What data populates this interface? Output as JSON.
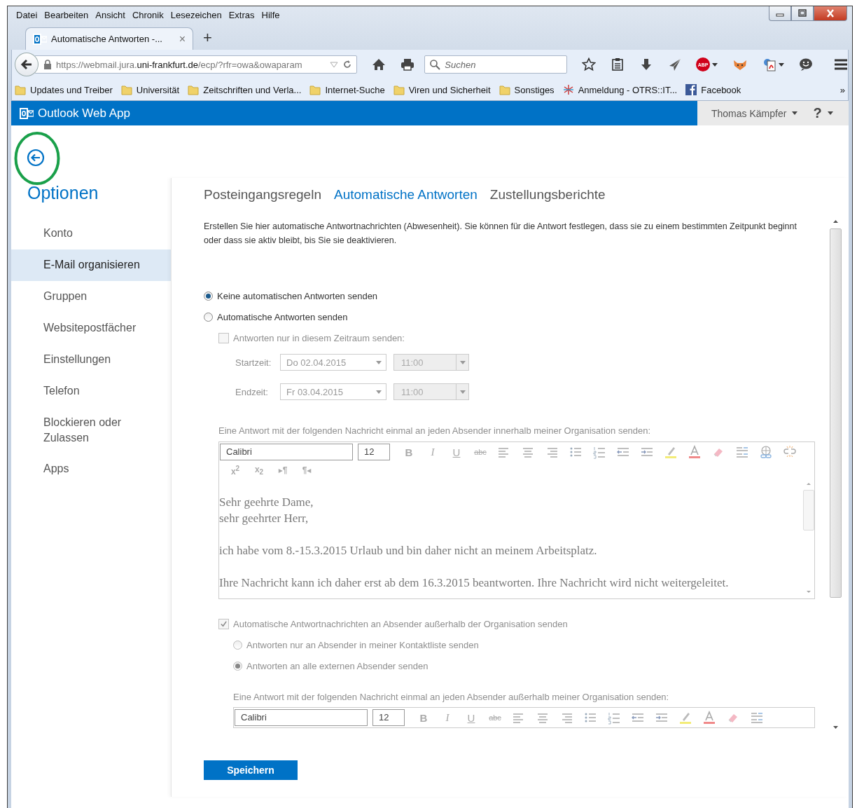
{
  "browser": {
    "menu": [
      "Datei",
      "Bearbeiten",
      "Ansicht",
      "Chronik",
      "Lesezeichen",
      "Extras",
      "Hilfe"
    ],
    "tab": {
      "title": "Automatische Antworten -...",
      "close": "×"
    },
    "new_tab": "+",
    "url": {
      "prefix": "https://webmail.jura.",
      "domain": "uni-frankfurt.de",
      "path": "/ecp/?rfr=owa&owaparam"
    },
    "search": {
      "placeholder": "Suchen"
    },
    "abp": "ABP",
    "bookmarks": [
      {
        "label": "Updates und Treiber",
        "kind": "folder"
      },
      {
        "label": "Universität",
        "kind": "folder"
      },
      {
        "label": "Zeitschriften und Verla...",
        "kind": "folder"
      },
      {
        "label": "Internet-Suche",
        "kind": "folder"
      },
      {
        "label": "Viren und Sicherheit",
        "kind": "folder"
      },
      {
        "label": "Sonstiges",
        "kind": "folder"
      },
      {
        "label": "Anmeldung - OTRS::IT...",
        "kind": "star"
      },
      {
        "label": "Facebook",
        "kind": "logo"
      }
    ],
    "bookmarks_more": "»"
  },
  "app": {
    "title": "Outlook Web App",
    "user": "Thomas Kämpfer",
    "help": "?"
  },
  "sidebar": {
    "title": "Optionen",
    "items": [
      {
        "label": "Konto",
        "selected": false
      },
      {
        "label": "E-Mail organisieren",
        "selected": true
      },
      {
        "label": "Gruppen",
        "selected": false
      },
      {
        "label": "Websitepostfächer",
        "selected": false
      },
      {
        "label": "Einstellungen",
        "selected": false
      },
      {
        "label": "Telefon",
        "selected": false
      },
      {
        "label": "Blockieren oder Zulassen",
        "selected": false
      },
      {
        "label": "Apps",
        "selected": false
      }
    ]
  },
  "tabs": [
    {
      "label": "Posteingangsregeln",
      "selected": false
    },
    {
      "label": "Automatische Antworten",
      "selected": true
    },
    {
      "label": "Zustellungsberichte",
      "selected": false
    }
  ],
  "description": "Erstellen Sie hier automatische Antwortnachrichten (Abwesenheit). Sie können für die Antwort festlegen, dass sie zu einem bestimmten Zeitpunkt beginnt oder dass sie aktiv bleibt, bis Sie sie deaktivieren.",
  "reply_mode": [
    {
      "label": "Keine automatischen Antworten senden",
      "selected": true
    },
    {
      "label": "Automatische Antworten senden",
      "selected": false
    }
  ],
  "period": {
    "label": "Antworten nur in diesem Zeitraum senden:",
    "checked": false,
    "disabled": true,
    "rows": [
      {
        "label": "Startzeit:",
        "date": "Do 02.04.2015",
        "time": "11:00"
      },
      {
        "label": "Endzeit:",
        "date": "Fr 03.04.2015",
        "time": "11:00"
      }
    ]
  },
  "internal": {
    "label": "Eine Antwort mit der folgenden Nachricht einmal an jeden Absender innerhalb meiner Organisation senden:",
    "disabled": true,
    "editor": {
      "font": "Calibri",
      "size": "12",
      "tools": [
        {
          "kind": "bold",
          "glyph": "B"
        },
        {
          "kind": "italic",
          "glyph": "I"
        },
        {
          "kind": "underline",
          "glyph": "U"
        },
        {
          "kind": "strike",
          "glyph": "abc"
        },
        {
          "kind": "align-left"
        },
        {
          "kind": "align-center"
        },
        {
          "kind": "align-right"
        },
        {
          "kind": "bullets"
        },
        {
          "kind": "numbering"
        },
        {
          "kind": "outdent"
        },
        {
          "kind": "indent"
        },
        {
          "kind": "highlight"
        },
        {
          "kind": "font-color"
        },
        {
          "kind": "eraser"
        },
        {
          "kind": "styles"
        },
        {
          "kind": "link"
        },
        {
          "kind": "unlink"
        }
      ],
      "tools_row2": [
        {
          "kind": "text",
          "glyph": "x$^{2}$"
        },
        {
          "kind": "text",
          "glyph": "x$_{2}$"
        },
        {
          "kind": "text",
          "glyph": "▸¶"
        },
        {
          "kind": "text",
          "glyph": "¶◂"
        }
      ],
      "body": [
        [
          "Sehr geehrte Dame,",
          "sehr geehrter Herr,"
        ],
        [
          "ich habe vom 8.-15.3.2015 Urlaub und bin daher nicht an meinem Arbeitsplatz."
        ],
        [
          "Ihre Nachricht kann ich daher erst ab dem 16.3.2015 beantworten. Ihre Nachricht wird nicht weitergeleitet."
        ]
      ]
    }
  },
  "external": {
    "label": "Automatische Antwortnachrichten an Absender außerhalb der Organisation senden",
    "checked": true,
    "disabled": true,
    "options": [
      {
        "label": "Antworten nur an Absender in meiner Kontaktliste senden",
        "selected": false
      },
      {
        "label": "Antworten an alle externen Absender senden",
        "selected": true
      }
    ],
    "message_label": "Eine Antwort mit der folgenden Nachricht einmal an jeden Absender außerhalb meiner Organisation senden:",
    "editor": {
      "font": "Calibri",
      "size": "12",
      "tools": [
        {
          "kind": "bold",
          "glyph": "B"
        },
        {
          "kind": "italic",
          "glyph": "I"
        },
        {
          "kind": "underline",
          "glyph": "U"
        },
        {
          "kind": "strike",
          "glyph": "abc"
        },
        {
          "kind": "align-left"
        },
        {
          "kind": "align-center"
        },
        {
          "kind": "align-right"
        },
        {
          "kind": "bullets"
        },
        {
          "kind": "numbering"
        },
        {
          "kind": "outdent"
        },
        {
          "kind": "indent"
        },
        {
          "kind": "highlight"
        },
        {
          "kind": "font-color"
        },
        {
          "kind": "eraser"
        },
        {
          "kind": "styles"
        }
      ]
    }
  },
  "save": "Speichern"
}
